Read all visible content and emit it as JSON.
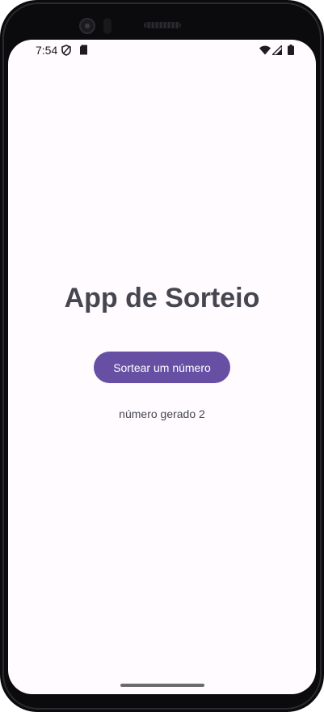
{
  "status_bar": {
    "time": "7:54",
    "left_icons": [
      "shield-icon",
      "sim-card-icon"
    ],
    "right_icons": [
      "wifi-icon",
      "cell-signal-icon",
      "battery-icon"
    ]
  },
  "app": {
    "title": "App de Sorteio",
    "button_label": "Sortear um número",
    "result_text": "número gerado 2"
  },
  "colors": {
    "background": "#fffbfe",
    "primary": "#6750a4",
    "on_primary": "#ffffff",
    "text": "#45464f"
  }
}
